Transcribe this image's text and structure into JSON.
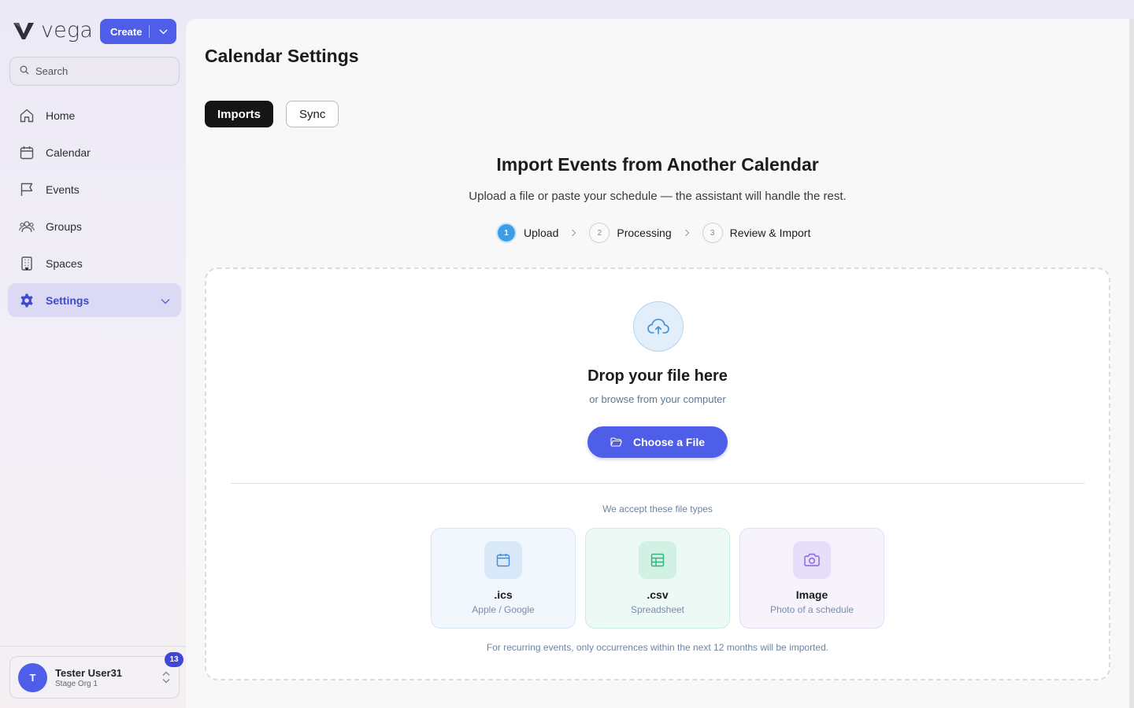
{
  "brand": {
    "name": "vega",
    "create_label": "Create"
  },
  "search": {
    "placeholder": "Search"
  },
  "sidebar": {
    "items": [
      {
        "label": "Home",
        "icon": "home-icon"
      },
      {
        "label": "Calendar",
        "icon": "calendar-icon"
      },
      {
        "label": "Events",
        "icon": "flag-icon"
      },
      {
        "label": "Groups",
        "icon": "users-icon"
      },
      {
        "label": "Spaces",
        "icon": "building-icon"
      },
      {
        "label": "Settings",
        "icon": "gear-icon",
        "active": true
      }
    ]
  },
  "user": {
    "initial": "T",
    "name": "Tester User31",
    "org": "Stage Org 1",
    "notifications": "13"
  },
  "page": {
    "title": "Calendar Settings",
    "tabs": [
      {
        "label": "Imports",
        "active": true
      },
      {
        "label": "Sync",
        "active": false
      }
    ]
  },
  "import": {
    "title": "Import Events from Another Calendar",
    "subtitle": "Upload a file or paste your schedule — the assistant will handle the rest.",
    "steps": [
      {
        "num": "1",
        "label": "Upload",
        "current": true
      },
      {
        "num": "2",
        "label": "Processing",
        "current": false
      },
      {
        "num": "3",
        "label": "Review & Import",
        "current": false
      }
    ],
    "drop_title": "Drop your file here",
    "drop_sub": "or browse from your computer",
    "choose_label": "Choose a File",
    "accept_label": "We accept these file types",
    "types": [
      {
        "name": ".ics",
        "desc": "Apple / Google",
        "icon": "calendar-icon",
        "color": "#3d8be0"
      },
      {
        "name": ".csv",
        "desc": "Spreadsheet",
        "icon": "table-icon",
        "color": "#2eb57e"
      },
      {
        "name": "Image",
        "desc": "Photo of a schedule",
        "icon": "camera-icon",
        "color": "#8a62d9"
      }
    ],
    "footnote": "For recurring events, only occurrences within the next 12 months will be imported."
  },
  "colors": {
    "accent": "#4f5ee8",
    "step_active": "#3d9ee8",
    "settings_active_bg": "#dcd9f4"
  }
}
